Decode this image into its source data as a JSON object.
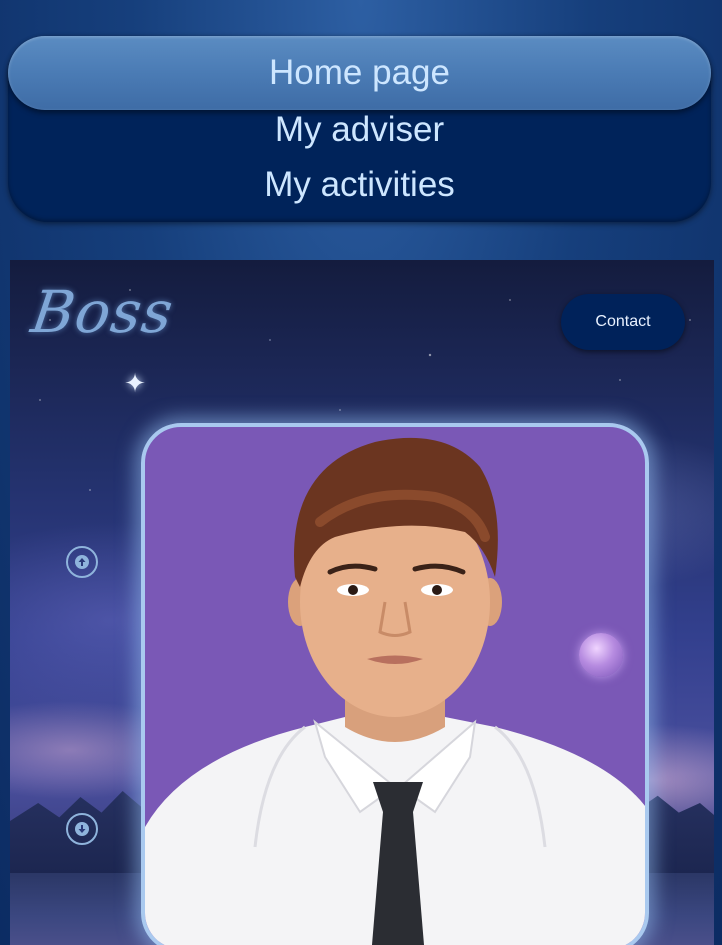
{
  "nav": {
    "items": [
      {
        "label": "Home page",
        "active": true
      },
      {
        "label": "My adviser",
        "active": false
      },
      {
        "label": "My activities",
        "active": false
      }
    ]
  },
  "hero": {
    "logo_text": "Boss",
    "contact_label": "Contact",
    "icons": {
      "sparkle": "sparkle-icon",
      "scroll_up": "arrow-up-circle-icon",
      "scroll_down": "arrow-down-circle-icon"
    }
  },
  "colors": {
    "nav_panel": "#00235a",
    "nav_active": "#4c7db6",
    "nav_text": "#cde6ff",
    "contact_button": "#00225a",
    "accent_light": "#a9c9ef"
  }
}
